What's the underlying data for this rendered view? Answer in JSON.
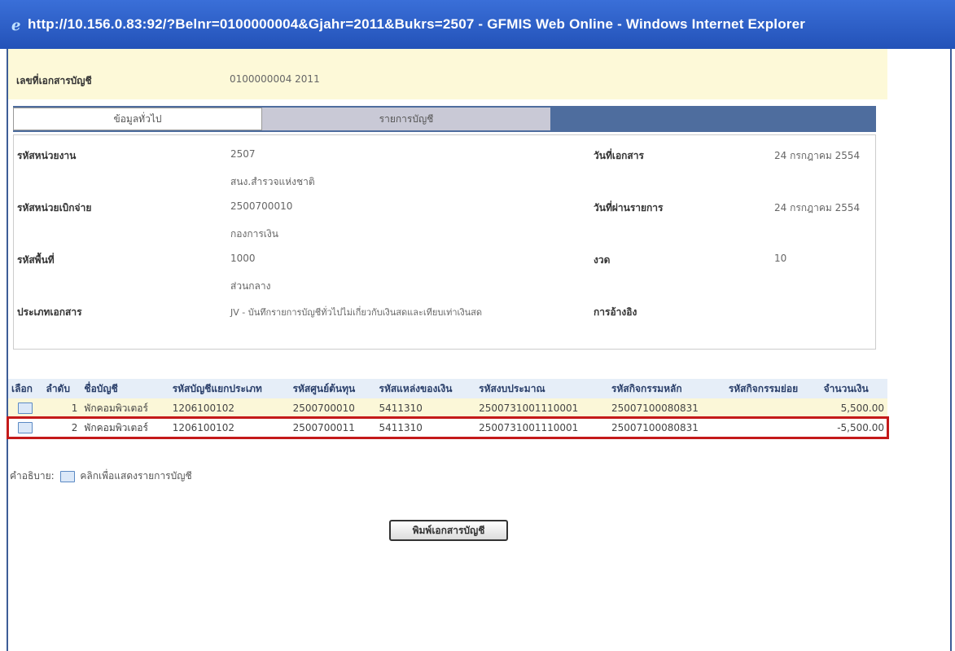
{
  "window": {
    "title": "http://10.156.0.83:92/?Belnr=0100000004&Gjahr=2011&Bukrs=2507 - GFMIS Web Online - Windows Internet Explorer"
  },
  "header": {
    "label": "เลขที่เอกสารบัญชี",
    "value": "0100000004 2011"
  },
  "tabs": [
    {
      "label": "ข้อมูลทั่วไป"
    },
    {
      "label": "รายการบัญชี"
    }
  ],
  "info": {
    "unit_label": "รหัสหน่วยงาน",
    "unit_code": "2507",
    "unit_name": "สนง.สำรวจแห่งชาติ",
    "disb_label": "รหัสหน่วยเบิกจ่าย",
    "disb_code": "2500700010",
    "disb_name": "กองการเงิน",
    "area_label": "รหัสพื้นที่",
    "area_code": "1000",
    "area_name": "ส่วนกลาง",
    "doctype_label": "ประเภทเอกสาร",
    "doctype_value": "JV - บันทึกรายการบัญชีทั่วไปไม่เกี่ยวกับเงินสดและเทียบเท่าเงินสด",
    "docdate_label": "วันที่เอกสาร",
    "docdate_value": "24 กรกฎาคม 2554",
    "postdate_label": "วันที่ผ่านรายการ",
    "postdate_value": "24 กรกฎาคม 2554",
    "period_label": "งวด",
    "period_value": "10",
    "ref_label": "การอ้างอิง"
  },
  "table": {
    "columns": [
      "เลือก",
      "ลำดับ",
      "ชื่อบัญชี",
      "รหัสบัญชีแยกประเภท",
      "รหัสศูนย์ต้นทุน",
      "รหัสแหล่งของเงิน",
      "รหัสงบประมาณ",
      "รหัสกิจกรรมหลัก",
      "รหัสกิจกรรมย่อย",
      "จำนวนเงิน"
    ],
    "rows": [
      {
        "seq": "1",
        "name": "พักคอมพิวเตอร์",
        "gl": "1206100102",
        "cost": "2500700010",
        "fund": "5411310",
        "budget": "2500731001110001",
        "activity": "25007100080831",
        "sub": "",
        "amount": "5,500.00"
      },
      {
        "seq": "2",
        "name": "พักคอมพิวเตอร์",
        "gl": "1206100102",
        "cost": "2500700011",
        "fund": "5411310",
        "budget": "2500731001110001",
        "activity": "25007100080831",
        "sub": "",
        "amount": "-5,500.00"
      }
    ]
  },
  "legend": {
    "prefix": "คำอธิบาย:",
    "text": "คลิกเพื่อแสดงรายการบัญชี"
  },
  "buttons": {
    "save": "พิมพ์เอกสารบัญชี"
  }
}
